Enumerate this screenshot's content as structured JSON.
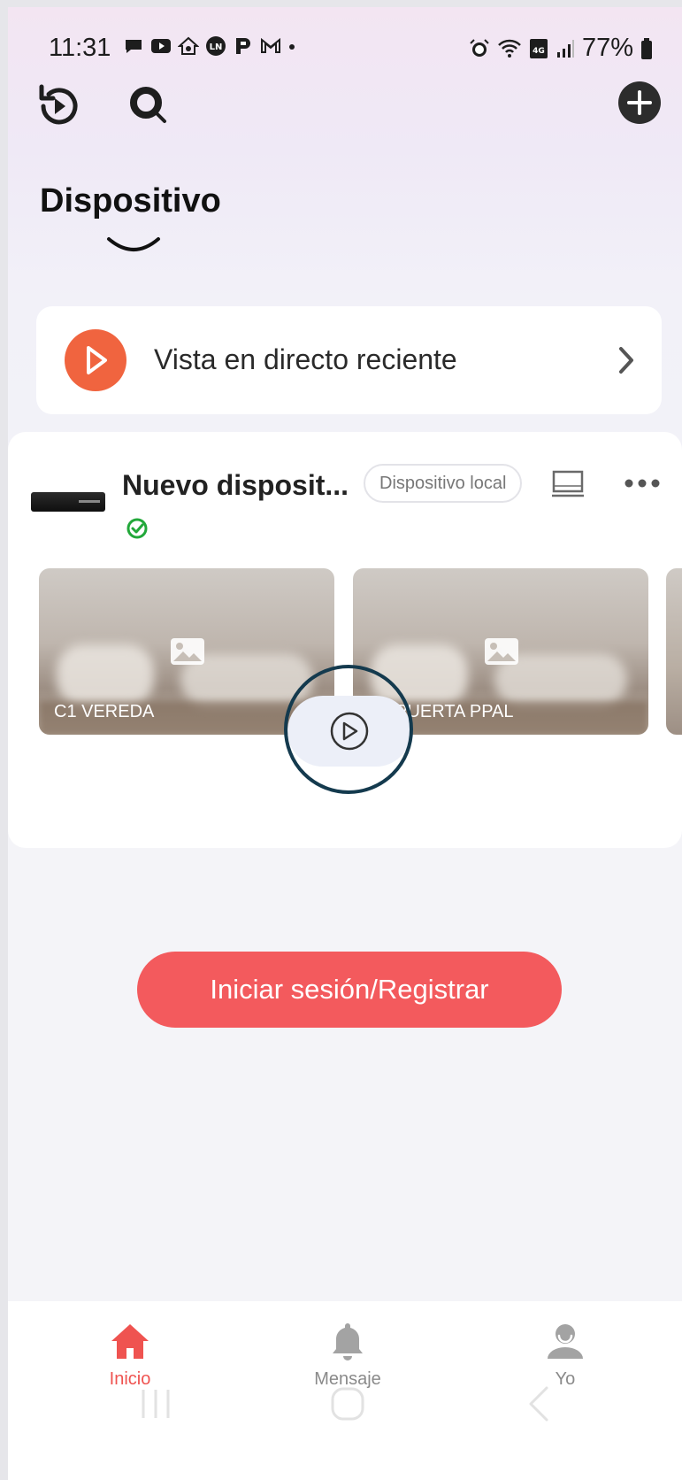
{
  "status_bar": {
    "time": "11:31",
    "battery": "77%",
    "network_badge": "Vo) 4G"
  },
  "top_bar": {
    "icons": [
      "playback-history-icon",
      "search-icon",
      "add-icon"
    ]
  },
  "page": {
    "title": "Dispositivo"
  },
  "recent_live": {
    "label": "Vista en directo reciente"
  },
  "device": {
    "name": "Nuevo disposit...",
    "badge": "Dispositivo local",
    "status": "online",
    "cameras": [
      {
        "label": "C1 VEREDA"
      },
      {
        "label": "C2 PUERTA PPAL"
      }
    ]
  },
  "login_button": {
    "label": "Iniciar sesión/Registrar"
  },
  "bottom_nav": {
    "items": [
      {
        "label": "Inicio",
        "active": true
      },
      {
        "label": "Mensaje",
        "active": false
      },
      {
        "label": "Yo",
        "active": false
      }
    ]
  },
  "colors": {
    "accent": "#f35a5d",
    "active_nav": "#ef5350",
    "inactive_nav": "#9b9b9b",
    "online": "#22a83a"
  }
}
